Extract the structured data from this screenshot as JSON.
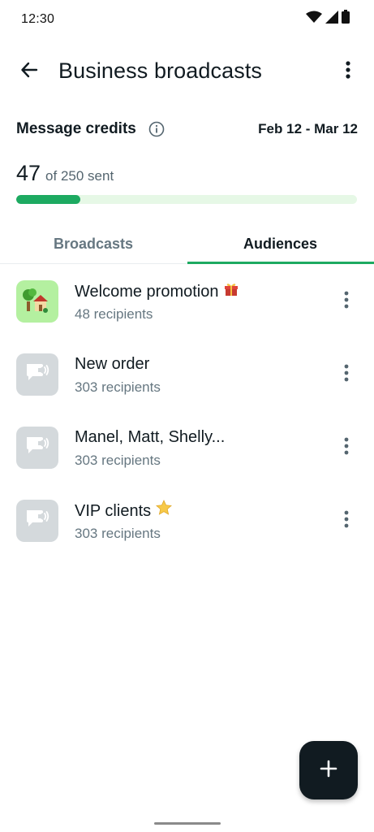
{
  "status_bar": {
    "time": "12:30"
  },
  "header": {
    "title": "Business broadcasts"
  },
  "credits": {
    "label": "Message credits",
    "date_range": "Feb 12 - Mar 12",
    "sent": "47",
    "sent_of": "of 250 sent",
    "progress_fraction": 0.188
  },
  "tabs": [
    {
      "label": "Broadcasts",
      "selected": false
    },
    {
      "label": "Audiences",
      "selected": true
    }
  ],
  "audiences": [
    {
      "title": "Welcome promotion",
      "emoji": "🎁",
      "subtitle": "48 recipients",
      "avatar": "house-tree-icon"
    },
    {
      "title": "New order",
      "emoji": "",
      "subtitle": "303 recipients",
      "avatar": "broadcast-icon"
    },
    {
      "title": "Manel, Matt, Shelly...",
      "emoji": "",
      "subtitle": "303 recipients",
      "avatar": "broadcast-icon"
    },
    {
      "title": "VIP clients",
      "emoji": "⭐",
      "subtitle": "303 recipients",
      "avatar": "broadcast-icon"
    }
  ],
  "colors": {
    "accent": "#1daa61",
    "progress_track": "#e6f8e6",
    "fab": "#111b21"
  }
}
